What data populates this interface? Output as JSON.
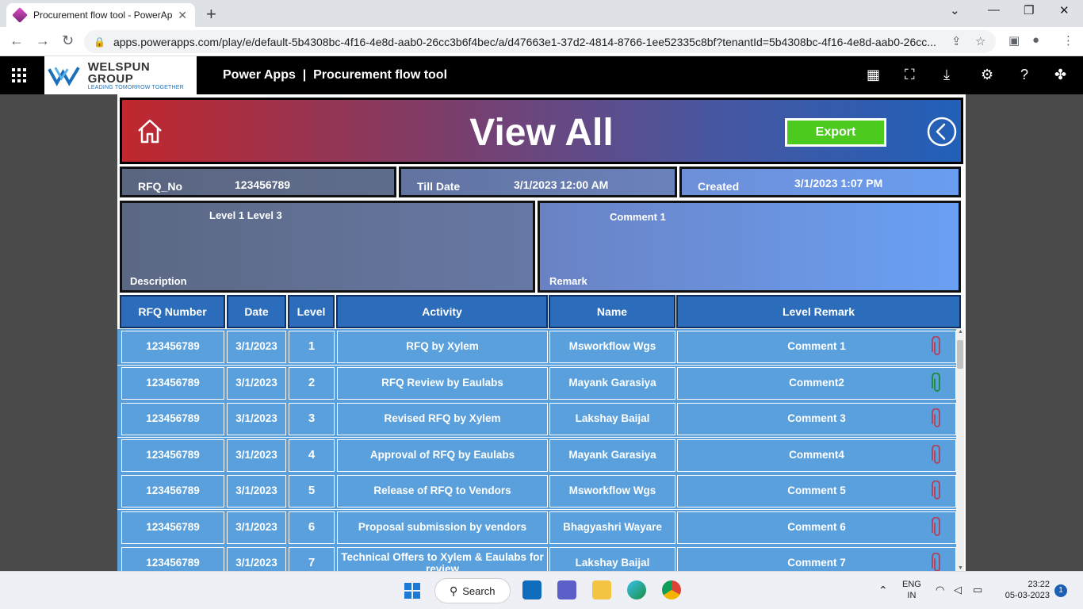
{
  "browser": {
    "tab_title": "Procurement flow tool - PowerApps",
    "tab_close": "✕",
    "new_tab": "+",
    "url": "apps.powerapps.com/play/e/default-5b4308bc-4f16-4e8d-aab0-26cc3b6f4bec/a/d47663e1-37d2-4814-8766-1ee52335c8bf?tenantId=5b4308bc-4f16-4e8d-aab0-26cc..."
  },
  "header": {
    "logo_name": "WELSPUN GROUP",
    "logo_tagline": "LEADING TOMORROW TOGETHER",
    "app_title": "Power Apps  |  Procurement flow tool"
  },
  "banner": {
    "title": "View All",
    "export_label": "Export"
  },
  "info": {
    "rfq_label": "RFQ_No",
    "rfq_value": "123456789",
    "till_label": "Till Date",
    "till_value": "3/1/2023 12:00 AM",
    "created_label": "Created",
    "created_value": "3/1/2023 1:07 PM",
    "description_label": "Description",
    "description_value": "Level 1 Level 3",
    "remark_label": "Remark",
    "remark_value": "Comment 1"
  },
  "table": {
    "headers": [
      "RFQ Number",
      "Date",
      "Level",
      "Activity",
      "Name",
      "Level Remark"
    ],
    "rows": [
      {
        "rfq": "123456789",
        "date": "3/1/2023",
        "level": "1",
        "activity": "RFQ by Xylem",
        "name": "Msworkflow Wgs",
        "remark": "Comment 1",
        "clip_color": "#b0415c"
      },
      {
        "rfq": "123456789",
        "date": "3/1/2023",
        "level": "2",
        "activity": "RFQ Review by Eaulabs",
        "name": "Mayank Garasiya",
        "remark": "Comment2",
        "clip_color": "#1e8a3a"
      },
      {
        "rfq": "123456789",
        "date": "3/1/2023",
        "level": "3",
        "activity": "Revised RFQ by Xylem",
        "name": "Lakshay Baijal",
        "remark": "Comment 3",
        "clip_color": "#b0415c"
      },
      {
        "rfq": "123456789",
        "date": "3/1/2023",
        "level": "4",
        "activity": "Approval of RFQ by Eaulabs",
        "name": "Mayank Garasiya",
        "remark": "Comment4",
        "clip_color": "#b0415c"
      },
      {
        "rfq": "123456789",
        "date": "3/1/2023",
        "level": "5",
        "activity": "Release of RFQ to Vendors",
        "name": "Msworkflow Wgs",
        "remark": "Comment 5",
        "clip_color": "#b0415c"
      },
      {
        "rfq": "123456789",
        "date": "3/1/2023",
        "level": "6",
        "activity": "Proposal submission by vendors",
        "name": "Bhagyashri Wayare",
        "remark": "Comment 6",
        "clip_color": "#b0415c"
      },
      {
        "rfq": "123456789",
        "date": "3/1/2023",
        "level": "7",
        "activity": "Technical Offers to Xylem & Eaulabs for review",
        "name": "Lakshay Baijal",
        "remark": "Comment 7",
        "clip_color": "#b0415c"
      }
    ]
  },
  "taskbar": {
    "search_label": "Search",
    "lang_top": "ENG",
    "lang_bottom": "IN",
    "time": "23:22",
    "date": "05-03-2023",
    "notification_count": "1"
  }
}
